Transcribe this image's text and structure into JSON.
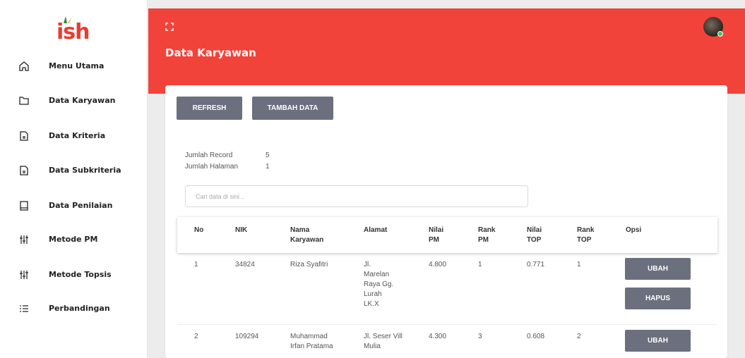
{
  "brand": {
    "logo_text": "ish"
  },
  "sidebar": {
    "items": [
      {
        "label": "Menu Utama",
        "icon": "home-icon"
      },
      {
        "label": "Data Karyawan",
        "icon": "folder-icon"
      },
      {
        "label": "Data Kriteria",
        "icon": "document-icon"
      },
      {
        "label": "Data Subkriteria",
        "icon": "document-icon"
      },
      {
        "label": "Data Penilaian",
        "icon": "book-icon"
      },
      {
        "label": "Metode PM",
        "icon": "sliders-icon"
      },
      {
        "label": "Metode Topsis",
        "icon": "sliders-icon"
      },
      {
        "label": "Perbandingan",
        "icon": "list-icon"
      }
    ]
  },
  "header": {
    "title": "Data Karyawan"
  },
  "toolbar": {
    "refresh_label": "REFRESH",
    "add_label": "TAMBAH DATA"
  },
  "stats": {
    "record_label": "Jumlah Record",
    "record_value": "5",
    "page_label": "Jumlah Halaman",
    "page_value": "1"
  },
  "search": {
    "placeholder": "Cari data di sini .."
  },
  "table": {
    "headers": {
      "no": "No",
      "nik": "NIK",
      "nama": "Nama Karyawan",
      "alamat": "Alamat",
      "nilai_pm": "Nilai PM",
      "rank_pm": "Rank PM",
      "nilai_top": "Nilai TOP",
      "rank_top": "Rank TOP",
      "opsi": "Opsi"
    },
    "rows": [
      {
        "no": "1",
        "nik": "34824",
        "nama": "Riza Syafitri",
        "alamat": "Jl. Marelan Raya Gg. Lurah LK.X",
        "nilai_pm": "4.800",
        "rank_pm": "1",
        "nilai_top": "0.771",
        "rank_top": "1"
      },
      {
        "no": "2",
        "nik": "109294",
        "nama": "Muhammad Irfan Pratama",
        "alamat": "Jl. Seser Vill Mulia",
        "nilai_pm": "4.300",
        "rank_pm": "3",
        "nilai_top": "0.608",
        "rank_top": "2"
      }
    ],
    "edit_label": "UBAH",
    "delete_label": "HAPUS"
  },
  "colors": {
    "accent": "#f2433b",
    "button": "#6c6f7e",
    "brand": "#ec3b30"
  }
}
